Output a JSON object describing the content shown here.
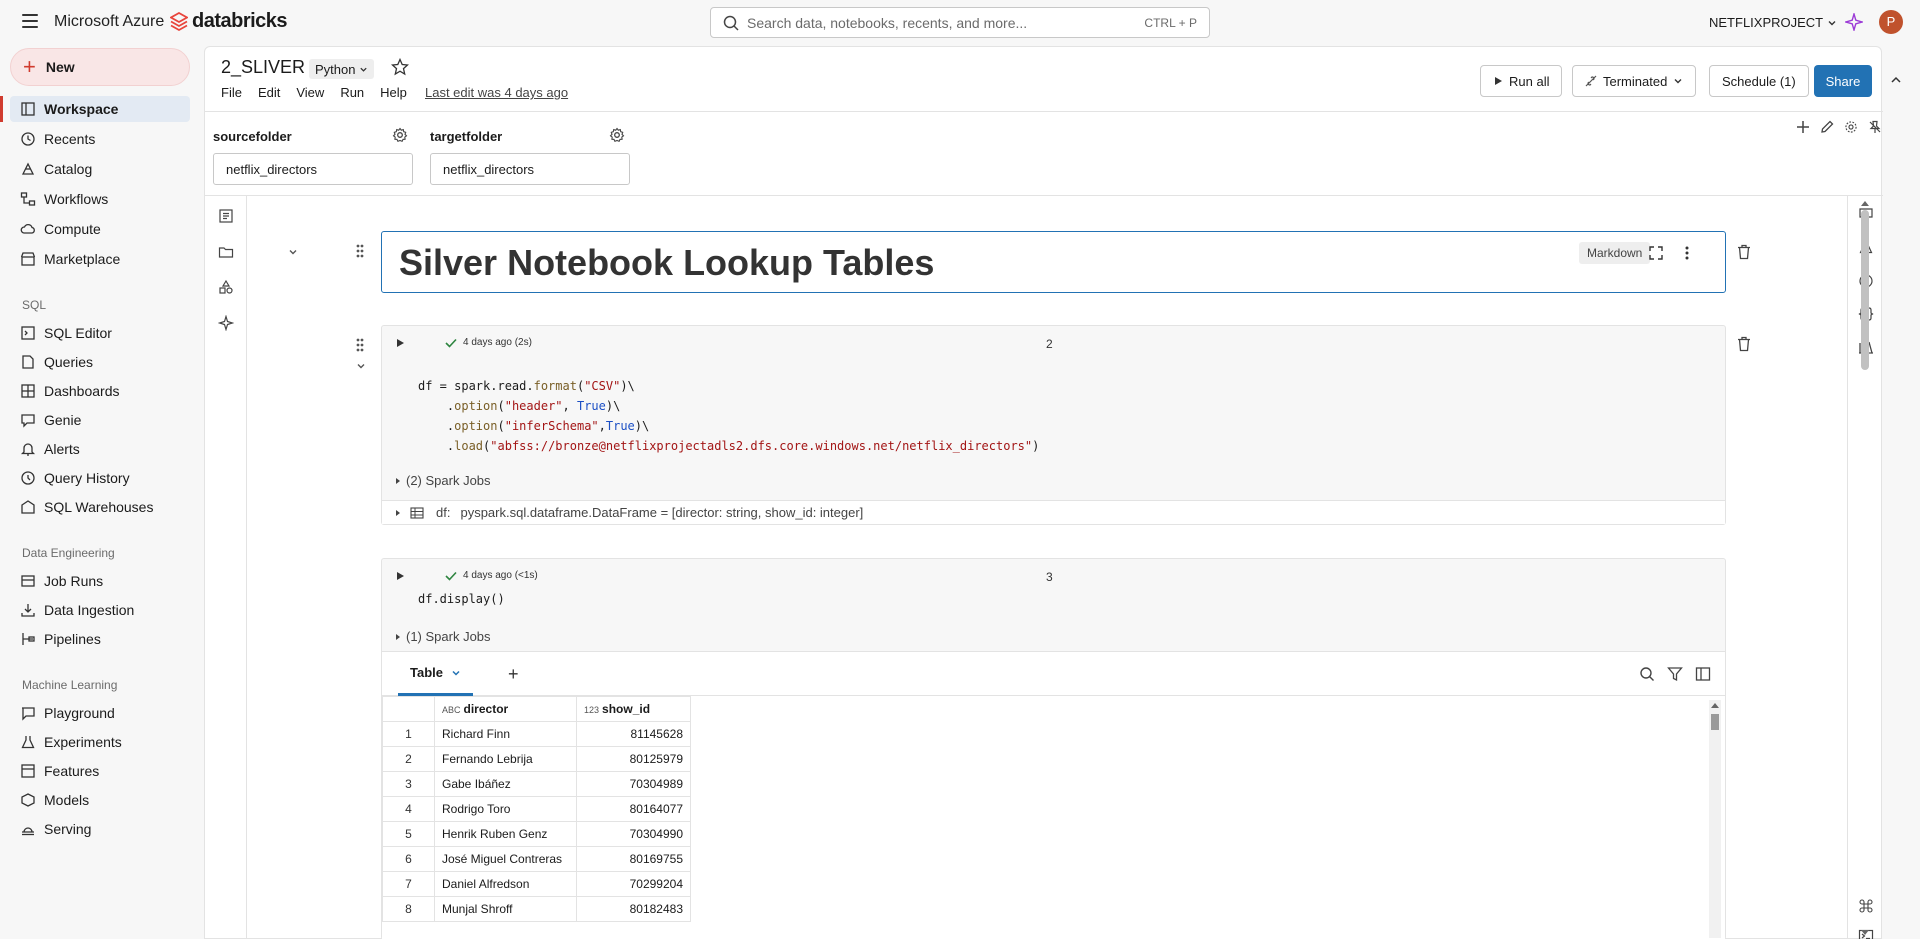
{
  "topbar": {
    "brand_azure": "Microsoft Azure",
    "brand_databricks": "databricks",
    "search_placeholder": "Search data, notebooks, recents, and more...",
    "search_shortcut": "CTRL + P",
    "workspace": "NETFLIXPROJECT",
    "avatar_letter": "P"
  },
  "sidebar": {
    "new_label": "New",
    "items": [
      {
        "label": "Workspace",
        "icon": "workspace-icon"
      },
      {
        "label": "Recents",
        "icon": "clock-icon"
      },
      {
        "label": "Catalog",
        "icon": "catalog-icon"
      },
      {
        "label": "Workflows",
        "icon": "workflows-icon"
      },
      {
        "label": "Compute",
        "icon": "cloud-icon"
      },
      {
        "label": "Marketplace",
        "icon": "store-icon"
      }
    ],
    "sql_section": "SQL",
    "sql_items": [
      {
        "label": "SQL Editor",
        "icon": "sql-editor-icon"
      },
      {
        "label": "Queries",
        "icon": "query-icon"
      },
      {
        "label": "Dashboards",
        "icon": "dashboard-icon"
      },
      {
        "label": "Genie",
        "icon": "genie-icon"
      },
      {
        "label": "Alerts",
        "icon": "bell-icon"
      },
      {
        "label": "Query History",
        "icon": "history-icon"
      },
      {
        "label": "SQL Warehouses",
        "icon": "warehouse-icon"
      }
    ],
    "de_section": "Data Engineering",
    "de_items": [
      {
        "label": "Job Runs",
        "icon": "job-runs-icon"
      },
      {
        "label": "Data Ingestion",
        "icon": "ingestion-icon"
      },
      {
        "label": "Pipelines",
        "icon": "pipeline-icon"
      }
    ],
    "ml_section": "Machine Learning",
    "ml_items": [
      {
        "label": "Playground",
        "icon": "playground-icon"
      },
      {
        "label": "Experiments",
        "icon": "flask-icon"
      },
      {
        "label": "Features",
        "icon": "features-icon"
      },
      {
        "label": "Models",
        "icon": "models-icon"
      },
      {
        "label": "Serving",
        "icon": "serving-icon"
      }
    ]
  },
  "notebook": {
    "title": "2_SLIVER",
    "language": "Python",
    "menu": [
      "File",
      "Edit",
      "View",
      "Run",
      "Help"
    ],
    "last_edit": "Last edit was 4 days ago",
    "run_all": "Run all",
    "compute_status": "Terminated",
    "schedule": "Schedule (1)",
    "share": "Share"
  },
  "widgets": [
    {
      "label": "sourcefolder",
      "value": "netflix_directors"
    },
    {
      "label": "targetfolder",
      "value": "netflix_directors"
    }
  ],
  "cells": {
    "markdown": {
      "heading": "Silver Notebook Lookup Tables",
      "badge": "Markdown"
    },
    "cell2": {
      "status": "4 days ago (2s)",
      "number": "2",
      "spark_jobs": "(2) Spark Jobs",
      "df_label": "df:",
      "df_schema": "pyspark.sql.dataframe.DataFrame = [director: string, show_id: integer]"
    },
    "cell3": {
      "status": "4 days ago (<1s)",
      "number": "3",
      "code": "df.display()",
      "spark_jobs": "(1) Spark Jobs"
    }
  },
  "results": {
    "tab": "Table",
    "columns": [
      {
        "name": "director",
        "type": "ABC"
      },
      {
        "name": "show_id",
        "type": "123"
      }
    ],
    "rows": [
      {
        "i": "1",
        "director": "Richard Finn",
        "show_id": "81145628"
      },
      {
        "i": "2",
        "director": "Fernando Lebrija",
        "show_id": "80125979"
      },
      {
        "i": "3",
        "director": "Gabe Ibáñez",
        "show_id": "70304989"
      },
      {
        "i": "4",
        "director": "Rodrigo Toro",
        "show_id": "80164077"
      },
      {
        "i": "5",
        "director": "Henrik Ruben Genz",
        "show_id": "70304990"
      },
      {
        "i": "6",
        "director": "José Miguel Contreras",
        "show_id": "80169755"
      },
      {
        "i": "7",
        "director": "Daniel Alfredson",
        "show_id": "70299204"
      },
      {
        "i": "8",
        "director": "Munjal Shroff",
        "show_id": "80182483"
      }
    ]
  },
  "colors": {
    "accent": "#2272b4",
    "brand": "#d03b2e",
    "success": "#2e8540"
  }
}
